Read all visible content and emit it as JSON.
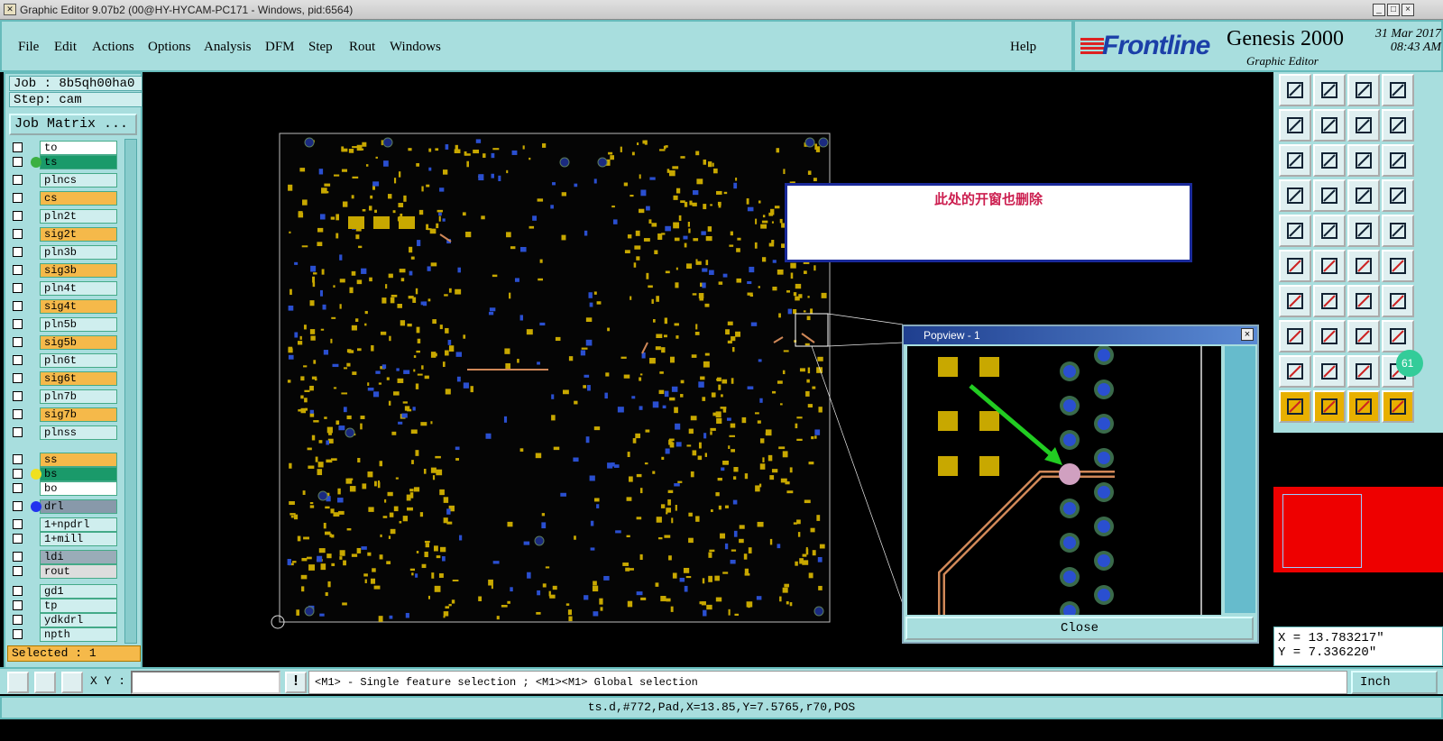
{
  "window": {
    "title": "Graphic Editor 9.07b2 (00@HY-HYCAM-PC171 - Windows, pid:6564)"
  },
  "menu": {
    "items": [
      "File",
      "Edit",
      "Actions",
      "Options",
      "Analysis",
      "DFM",
      "Step",
      "Rout",
      "Windows"
    ],
    "help": "Help"
  },
  "brand": {
    "logo_text": "Frontline",
    "product": "Genesis 2000",
    "subtitle": "Graphic Editor",
    "date": "31 Mar 2017",
    "time": "08:43 AM"
  },
  "left": {
    "job": "Job : 8b5qh00ha0",
    "step": "Step: cam",
    "job_matrix": "Job Matrix ...",
    "selected": "Selected : 1",
    "layers": [
      {
        "name": "to",
        "color": "#ffffff",
        "dot": ""
      },
      {
        "name": "ts",
        "color": "#1a9a6a",
        "dot": "#3cb043"
      },
      {
        "name": "plncs",
        "color": "#cfeeee",
        "dot": ""
      },
      {
        "name": "cs",
        "color": "#f5b94a",
        "dot": ""
      },
      {
        "name": "pln2t",
        "color": "#cfeeee",
        "dot": ""
      },
      {
        "name": "sig2t",
        "color": "#f5b94a",
        "dot": ""
      },
      {
        "name": "pln3b",
        "color": "#cfeeee",
        "dot": ""
      },
      {
        "name": "sig3b",
        "color": "#f5b94a",
        "dot": ""
      },
      {
        "name": "pln4t",
        "color": "#cfeeee",
        "dot": ""
      },
      {
        "name": "sig4t",
        "color": "#f5b94a",
        "dot": ""
      },
      {
        "name": "pln5b",
        "color": "#cfeeee",
        "dot": ""
      },
      {
        "name": "sig5b",
        "color": "#f5b94a",
        "dot": ""
      },
      {
        "name": "pln6t",
        "color": "#cfeeee",
        "dot": ""
      },
      {
        "name": "sig6t",
        "color": "#f5b94a",
        "dot": ""
      },
      {
        "name": "pln7b",
        "color": "#cfeeee",
        "dot": ""
      },
      {
        "name": "sig7b",
        "color": "#f5b94a",
        "dot": ""
      },
      {
        "name": "plnss",
        "color": "#cfeeee",
        "dot": ""
      },
      {
        "name": "ss",
        "color": "#f5b94a",
        "dot": ""
      },
      {
        "name": "bs",
        "color": "#1a9a6a",
        "dot": "#f0e020"
      },
      {
        "name": "bo",
        "color": "#ffffff",
        "dot": ""
      },
      {
        "name": "drl",
        "color": "#8899aa",
        "dot": "#2233ee"
      },
      {
        "name": "1+npdrl",
        "color": "#cfeeee",
        "dot": ""
      },
      {
        "name": "1+mill",
        "color": "#cfeeee",
        "dot": ""
      },
      {
        "name": "ldi",
        "color": "#9aacb8",
        "dot": ""
      },
      {
        "name": "rout",
        "color": "#dddddd",
        "dot": ""
      },
      {
        "name": "gd1",
        "color": "#cfeeee",
        "dot": ""
      },
      {
        "name": "tp",
        "color": "#cfeeee",
        "dot": ""
      },
      {
        "name": "ydkdrl",
        "color": "#cfeeee",
        "dot": ""
      },
      {
        "name": "npth",
        "color": "#cfeeee",
        "dot": ""
      }
    ]
  },
  "annotation": {
    "text": "此处的开窗也删除"
  },
  "popview": {
    "title": "Popview - 1",
    "close": "Close"
  },
  "coords": {
    "x": "X = 13.783217\"",
    "y": "Y = 7.336220\""
  },
  "bottom": {
    "xy_label": "X Y :",
    "xy_value": "",
    "message": "<M1> - Single feature selection ; <M1><M1> Global selection",
    "units": "Inch"
  },
  "status": {
    "text": "ts.d,#772,Pad,X=13.85,Y=7.5765,r70,POS"
  },
  "badge": {
    "text": "61"
  },
  "colors": {
    "panel": "#a8dede",
    "pad": "#c8a800",
    "via": "#2a4fd0",
    "trace": "#d08858",
    "arrow": "#22cc22",
    "highlight": "#cc1f50"
  }
}
